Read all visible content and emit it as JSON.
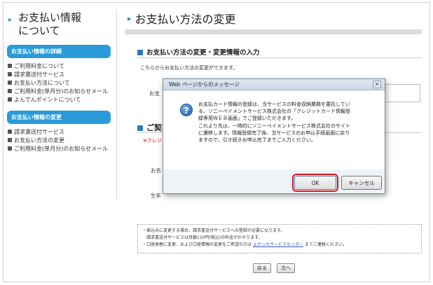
{
  "sidebar": {
    "title_line1": "お支払い情報",
    "title_line2": "について",
    "section1_header": "お支払い情報の詳細",
    "section1_items": [
      "ご利用料金について",
      "請求書送付サービス",
      "お支払い方法について",
      "ご利用料金(単月分)のお知らせメール",
      "よんでんポイントについて"
    ],
    "section2_header": "お支払い情報の変更",
    "section2_items": [
      "請求書送付サービス",
      "お支払い方法の変更",
      "ご利用料金(単月分)のお知らせメール"
    ]
  },
  "main": {
    "page_title": "お支払い方法の変更",
    "section1_heading": "お支払い方法の変更・変更情報の入力",
    "description": "こちらからお支払い方法の変更ができます。",
    "label_method": "お支",
    "section2_heading": "ご契",
    "red_note": "※クレジ",
    "label_name": "お名",
    "label_birth": "生年",
    "notes": {
      "line1": "・振込みに変更する場合、請求書送付サービスへの登録が必要になります。",
      "line2": "請求書送付サービスは月額110円(税込)の料金がかかります。",
      "line3_pre": "・口座振替に変更、および口座情報の変更をご希望の方は",
      "line3_link": "よかっちサービスセンター",
      "line3_post": "までご連絡ください。"
    },
    "back_button": "戻る",
    "next_button": "次へ"
  },
  "dialog": {
    "title": "Web ページからのメッセージ",
    "close": "×",
    "message_lines": [
      "お支払カード情報の登録は、当サービスの料金収納業務を委託してい",
      "る、ソニーペイメントサービス株式会社の「クレジットカード情報登",
      "録専用ＷＥＢ画面」でご登録いただきます。",
      "これより先は、一時的にソニーペイメントサービス株式会社のサイト",
      "に遷移します。情報登録完了後、当サービスのお申込手続画面に戻り",
      "ますので、引き続きお申込完了までご入力ください。"
    ],
    "ok_label": "OK",
    "cancel_label": "キャンセル"
  },
  "colors": {
    "accent": "#2b9ad8",
    "highlight": "#e0141e"
  }
}
